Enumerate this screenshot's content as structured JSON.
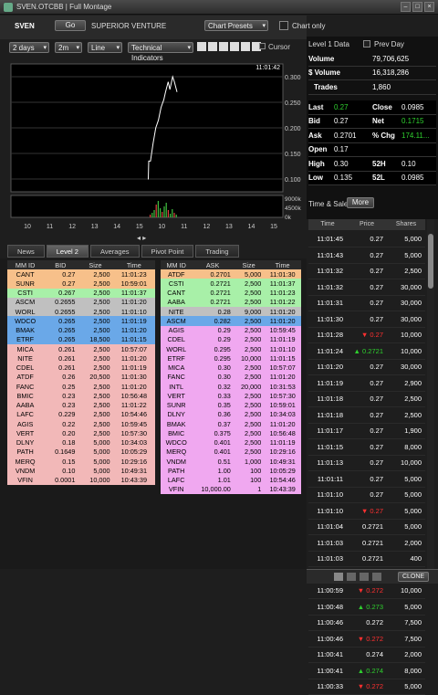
{
  "window": {
    "title": "SVEN.OTCBB | Full Montage"
  },
  "symbol": {
    "ticker": "SVEN",
    "go_label": "Go",
    "company": "SUPERIOR VENTURE"
  },
  "chart_controls": {
    "presets": "Chart Presets",
    "chart_only": "Chart only",
    "period": "2 days",
    "interval": "2m",
    "type": "Line",
    "indicators": "Technical Indicators",
    "cursor": "Cursor"
  },
  "chart_data": {
    "type": "line",
    "x_ticks": [
      "10",
      "11",
      "12",
      "13",
      "14",
      "15",
      "10",
      "11",
      "12",
      "13",
      "14",
      "15"
    ],
    "y_ticks": [
      "0.300",
      "0.250",
      "0.200",
      "0.150",
      "0.100"
    ],
    "ylim": [
      0.075,
      0.325
    ],
    "last_price": "0.270",
    "current_time": "11:01:42",
    "volume_ticks": [
      "9000k",
      "4500k",
      "0k"
    ],
    "series": [
      {
        "values": [
          [
            0.0,
            0.1
          ],
          [
            0.005,
            0.1
          ],
          [
            0.01,
            0.135
          ],
          [
            0.03,
            0.135
          ],
          [
            0.06,
            0.17
          ],
          [
            0.09,
            0.2
          ],
          [
            0.12,
            0.215
          ],
          [
            0.15,
            0.24
          ],
          [
            0.18,
            0.255
          ],
          [
            0.2,
            0.27
          ],
          [
            0.23,
            0.29
          ],
          [
            0.25,
            0.275
          ],
          [
            0.28,
            0.3
          ],
          [
            0.3,
            0.29
          ],
          [
            0.33,
            0.27
          ]
        ]
      }
    ]
  },
  "nav": {
    "prev_arrow": "◂",
    "next_arrow": "▸"
  },
  "tabs": [
    "News",
    "Level 2",
    "Averages",
    "Pivot Point",
    "Trading"
  ],
  "level2": {
    "bid_headers": [
      "MM ID",
      "BID",
      "Size",
      "Time"
    ],
    "ask_headers": [
      "MM ID",
      "ASK",
      "Size",
      "Time"
    ],
    "bids": [
      {
        "mm": "CANT",
        "price": "0.27",
        "size": "2,500",
        "time": "11:01:23",
        "color": "#f7c08a"
      },
      {
        "mm": "SUNR",
        "price": "0.27",
        "size": "2,500",
        "time": "10:59:01",
        "color": "#f7c08a"
      },
      {
        "mm": "CSTI",
        "price": "0.267",
        "size": "2,500",
        "time": "11:01:37",
        "color": "#a8f0a8"
      },
      {
        "mm": "ASCM",
        "price": "0.2655",
        "size": "2,500",
        "time": "11:01:20",
        "color": "#c0c0c0"
      },
      {
        "mm": "WORL",
        "price": "0.2655",
        "size": "2,500",
        "time": "11:01:10",
        "color": "#c0c0c0"
      },
      {
        "mm": "WDCO",
        "price": "0.265",
        "size": "2,500",
        "time": "11:01:19",
        "color": "#6aa8e8"
      },
      {
        "mm": "BMAK",
        "price": "0.265",
        "size": "2,500",
        "time": "11:01:20",
        "color": "#6aa8e8"
      },
      {
        "mm": "ETRF",
        "price": "0.265",
        "size": "18,500",
        "time": "11:01:15",
        "color": "#6aa8e8"
      },
      {
        "mm": "MICA",
        "price": "0.261",
        "size": "2,500",
        "time": "10:57:07",
        "color": "#f2b8b8"
      },
      {
        "mm": "NITE",
        "price": "0.261",
        "size": "2,500",
        "time": "11:01:20",
        "color": "#f2b8b8"
      },
      {
        "mm": "CDEL",
        "price": "0.261",
        "size": "2,500",
        "time": "11:01:19",
        "color": "#f2b8b8"
      },
      {
        "mm": "ATDF",
        "price": "0.26",
        "size": "20,500",
        "time": "11:01:30",
        "color": "#f2b8b8"
      },
      {
        "mm": "FANC",
        "price": "0.25",
        "size": "2,500",
        "time": "11:01:20",
        "color": "#f2b8b8"
      },
      {
        "mm": "BMIC",
        "price": "0.23",
        "size": "2,500",
        "time": "10:56:48",
        "color": "#f2b8b8"
      },
      {
        "mm": "AABA",
        "price": "0.23",
        "size": "2,500",
        "time": "11:01:22",
        "color": "#f2b8b8"
      },
      {
        "mm": "LAFC",
        "price": "0.229",
        "size": "2,500",
        "time": "10:54:46",
        "color": "#f2b8b8"
      },
      {
        "mm": "AGIS",
        "price": "0.22",
        "size": "2,500",
        "time": "10:59:45",
        "color": "#f2b8b8"
      },
      {
        "mm": "VERT",
        "price": "0.20",
        "size": "2,500",
        "time": "10:57:30",
        "color": "#f2b8b8"
      },
      {
        "mm": "DLNY",
        "price": "0.18",
        "size": "5,000",
        "time": "10:34:03",
        "color": "#f2b8b8"
      },
      {
        "mm": "PATH",
        "price": "0.1649",
        "size": "5,000",
        "time": "10:05:29",
        "color": "#f2b8b8"
      },
      {
        "mm": "MERQ",
        "price": "0.15",
        "size": "5,000",
        "time": "10:29:16",
        "color": "#f2b8b8"
      },
      {
        "mm": "VNDM",
        "price": "0.10",
        "size": "5,000",
        "time": "10:49:31",
        "color": "#f2b8b8"
      },
      {
        "mm": "VFIN",
        "price": "0.0001",
        "size": "10,000",
        "time": "10:43:39",
        "color": "#f2b8b8"
      }
    ],
    "asks": [
      {
        "mm": "ATDF",
        "price": "0.2701",
        "size": "5,000",
        "time": "11:01:30",
        "color": "#f7c08a"
      },
      {
        "mm": "CSTI",
        "price": "0.2721",
        "size": "2,500",
        "time": "11:01:37",
        "color": "#a8f0a8"
      },
      {
        "mm": "CANT",
        "price": "0.2721",
        "size": "2,500",
        "time": "11:01:23",
        "color": "#a8f0a8"
      },
      {
        "mm": "AABA",
        "price": "0.2721",
        "size": "2,500",
        "time": "11:01:22",
        "color": "#a8f0a8"
      },
      {
        "mm": "NITE",
        "price": "0.28",
        "size": "9,000",
        "time": "11:01:20",
        "color": "#c0c0c0"
      },
      {
        "mm": "ASCM",
        "price": "0.282",
        "size": "2,500",
        "time": "11:01:20",
        "color": "#6aa8e8"
      },
      {
        "mm": "AGIS",
        "price": "0.29",
        "size": "2,500",
        "time": "10:59:45",
        "color": "#f0a8f0"
      },
      {
        "mm": "CDEL",
        "price": "0.29",
        "size": "2,500",
        "time": "11:01:19",
        "color": "#f0a8f0"
      },
      {
        "mm": "WORL",
        "price": "0.295",
        "size": "2,500",
        "time": "11:01:10",
        "color": "#f0a8f0"
      },
      {
        "mm": "ETRF",
        "price": "0.295",
        "size": "10,000",
        "time": "11:01:15",
        "color": "#f0a8f0"
      },
      {
        "mm": "MICA",
        "price": "0.30",
        "size": "2,500",
        "time": "10:57:07",
        "color": "#f0a8f0"
      },
      {
        "mm": "FANC",
        "price": "0.30",
        "size": "2,500",
        "time": "11:01:20",
        "color": "#f0a8f0"
      },
      {
        "mm": "INTL",
        "price": "0.32",
        "size": "20,000",
        "time": "10:31:53",
        "color": "#f0a8f0"
      },
      {
        "mm": "VERT",
        "price": "0.33",
        "size": "2,500",
        "time": "10:57:30",
        "color": "#f0a8f0"
      },
      {
        "mm": "SUNR",
        "price": "0.35",
        "size": "2,500",
        "time": "10:59:01",
        "color": "#f0a8f0"
      },
      {
        "mm": "DLNY",
        "price": "0.36",
        "size": "2,500",
        "time": "10:34:03",
        "color": "#f0a8f0"
      },
      {
        "mm": "BMAK",
        "price": "0.37",
        "size": "2,500",
        "time": "11:01:20",
        "color": "#f0a8f0"
      },
      {
        "mm": "BMIC",
        "price": "0.375",
        "size": "2,500",
        "time": "10:56:48",
        "color": "#f0a8f0"
      },
      {
        "mm": "WDCO",
        "price": "0.401",
        "size": "2,500",
        "time": "11:01:19",
        "color": "#f0a8f0"
      },
      {
        "mm": "MERQ",
        "price": "0.401",
        "size": "2,500",
        "time": "10:29:16",
        "color": "#f0a8f0"
      },
      {
        "mm": "VNDM",
        "price": "0.51",
        "size": "1,000",
        "time": "10:49:31",
        "color": "#f0a8f0"
      },
      {
        "mm": "PATH",
        "price": "1.00",
        "size": "100",
        "time": "10:05:29",
        "color": "#f0a8f0"
      },
      {
        "mm": "LAFC",
        "price": "1.01",
        "size": "100",
        "time": "10:54:46",
        "color": "#f0a8f0"
      },
      {
        "mm": "VFIN",
        "price": "10,000.00",
        "size": "1",
        "time": "10:43:39",
        "color": "#f0a8f0"
      }
    ]
  },
  "level1": {
    "title": "Level 1 Data",
    "prev_day": "Prev Day",
    "volume_label": "Volume",
    "volume": "79,706,625",
    "dvolume_label": "$ Volume",
    "dvolume": "16,318,286",
    "trades_label": "Trades",
    "trades": "1,860",
    "last_label": "Last",
    "last": "0.27",
    "close_label": "Close",
    "close": "0.0985",
    "bid_label": "Bid",
    "bid": "0.27",
    "net_label": "Net",
    "net": "0.1715",
    "ask_label": "Ask",
    "ask": "0.2701",
    "chg_label": "% Chg",
    "chg": "174.11...",
    "open_label": "Open",
    "open": "0.17",
    "high_label": "High",
    "high": "0.30",
    "h52_label": "52H",
    "h52": "0.10",
    "low_label": "Low",
    "low": "0.135",
    "l52_label": "52L",
    "l52": "0.0985"
  },
  "timesales": {
    "title": "Time & Sales",
    "more": "More",
    "headers": [
      "Time",
      "Price",
      "Shares"
    ],
    "rows": [
      {
        "t": "11:01:45",
        "p": "0.27",
        "s": "5,000",
        "d": ""
      },
      {
        "t": "11:01:43",
        "p": "0.27",
        "s": "5,000",
        "d": ""
      },
      {
        "t": "11:01:32",
        "p": "0.27",
        "s": "2,500",
        "d": ""
      },
      {
        "t": "11:01:32",
        "p": "0.27",
        "s": "30,000",
        "d": ""
      },
      {
        "t": "11:01:31",
        "p": "0.27",
        "s": "30,000",
        "d": ""
      },
      {
        "t": "11:01:30",
        "p": "0.27",
        "s": "30,000",
        "d": ""
      },
      {
        "t": "11:01:28",
        "p": "0.27",
        "s": "10,000",
        "d": "down"
      },
      {
        "t": "11:01:24",
        "p": "0.2721",
        "s": "10,000",
        "d": "up"
      },
      {
        "t": "11:01:20",
        "p": "0.27",
        "s": "30,000",
        "d": ""
      },
      {
        "t": "11:01:19",
        "p": "0.27",
        "s": "2,900",
        "d": ""
      },
      {
        "t": "11:01:18",
        "p": "0.27",
        "s": "2,500",
        "d": ""
      },
      {
        "t": "11:01:18",
        "p": "0.27",
        "s": "2,500",
        "d": ""
      },
      {
        "t": "11:01:17",
        "p": "0.27",
        "s": "1,900",
        "d": ""
      },
      {
        "t": "11:01:15",
        "p": "0.27",
        "s": "8,000",
        "d": ""
      },
      {
        "t": "11:01:13",
        "p": "0.27",
        "s": "10,000",
        "d": ""
      },
      {
        "t": "11:01:11",
        "p": "0.27",
        "s": "5,000",
        "d": ""
      },
      {
        "t": "11:01:10",
        "p": "0.27",
        "s": "5,000",
        "d": ""
      },
      {
        "t": "11:01:10",
        "p": "0.27",
        "s": "5,000",
        "d": "down"
      },
      {
        "t": "11:01:04",
        "p": "0.2721",
        "s": "5,000",
        "d": ""
      },
      {
        "t": "11:01:03",
        "p": "0.2721",
        "s": "2,000",
        "d": ""
      },
      {
        "t": "11:01:03",
        "p": "0.2721",
        "s": "400",
        "d": ""
      },
      {
        "t": "11:01:02",
        "p": "0.2721",
        "s": "4,500",
        "d": "up"
      },
      {
        "t": "11:00:59",
        "p": "0.272",
        "s": "10,000",
        "d": "down"
      },
      {
        "t": "11:00:48",
        "p": "0.273",
        "s": "5,000",
        "d": "up"
      },
      {
        "t": "11:00:46",
        "p": "0.272",
        "s": "7,500",
        "d": ""
      },
      {
        "t": "11:00:46",
        "p": "0.272",
        "s": "7,500",
        "d": "down"
      },
      {
        "t": "11:00:41",
        "p": "0.274",
        "s": "2,000",
        "d": ""
      },
      {
        "t": "11:00:41",
        "p": "0.274",
        "s": "8,000",
        "d": "up"
      },
      {
        "t": "11:00:33",
        "p": "0.272",
        "s": "5,000",
        "d": "down"
      }
    ]
  },
  "statusbar": {
    "clone": "CLONE"
  }
}
